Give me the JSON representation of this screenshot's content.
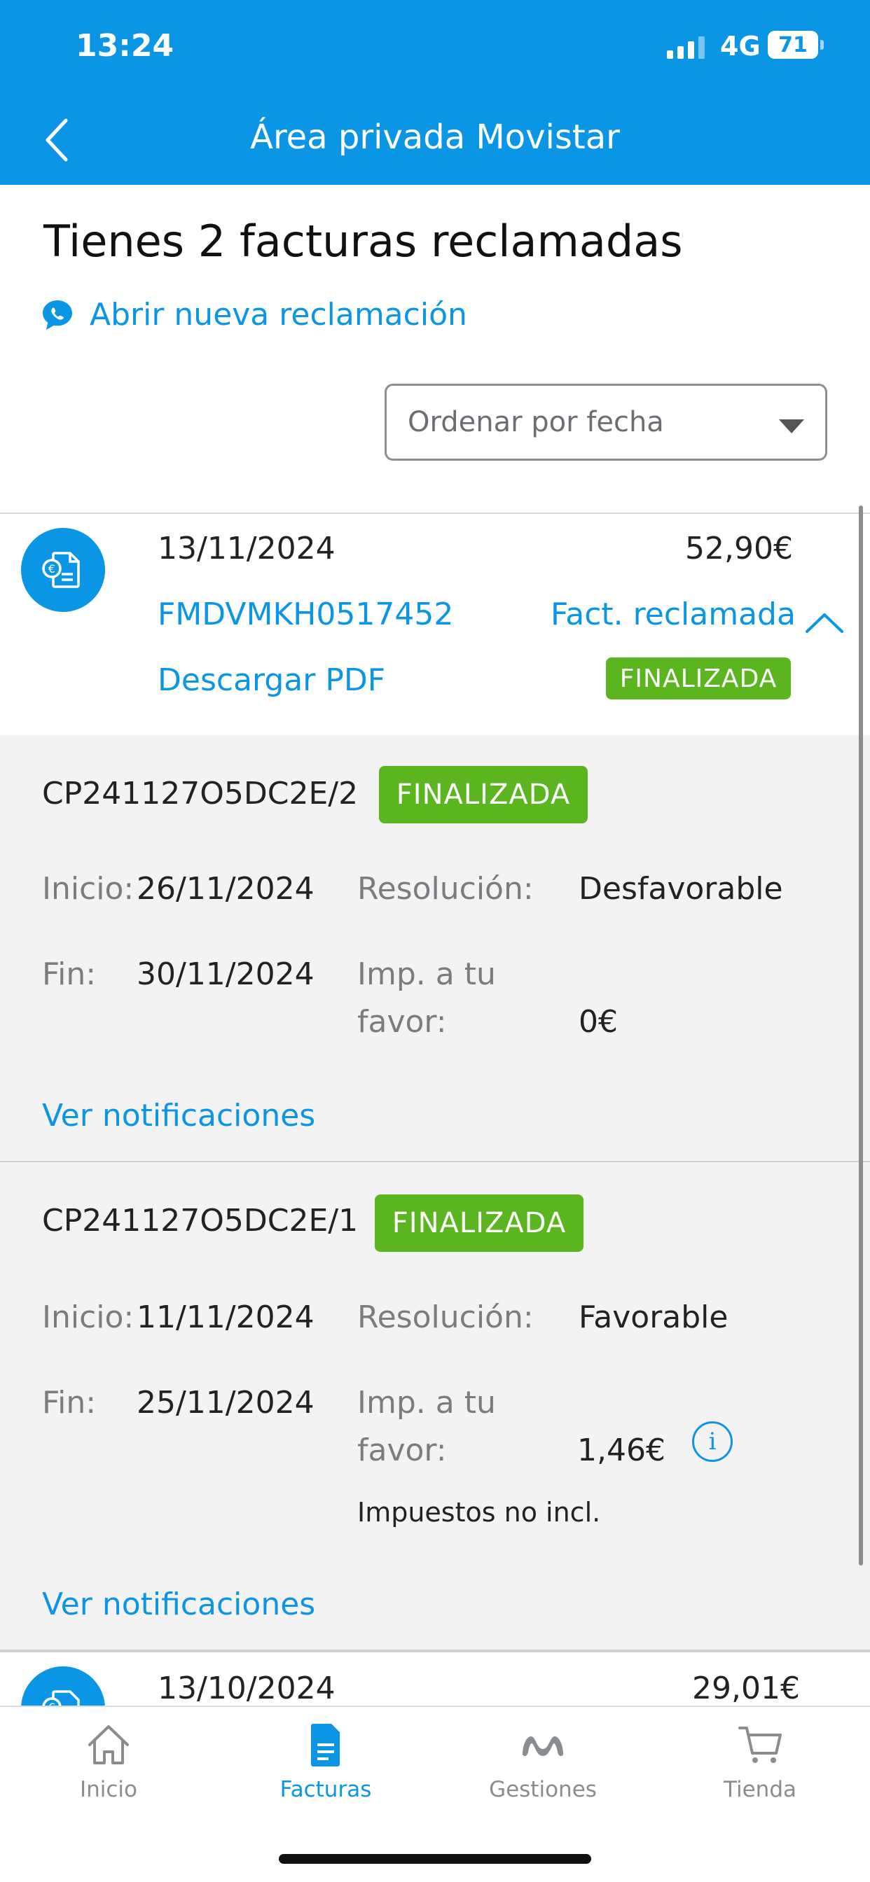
{
  "status": {
    "time": "13:24",
    "network": "4G",
    "battery": "71"
  },
  "header": {
    "title": "Área privada Movistar"
  },
  "page": {
    "heading": "Tienes 2 facturas reclamadas",
    "new_claim": "Abrir nueva reclamación"
  },
  "sort": {
    "value": "Ordenar por fecha"
  },
  "invoices": [
    {
      "date": "13/11/2024",
      "amount": "52,90€",
      "number": "FMDVMKH0517452",
      "claim_link": "Fact. reclamada",
      "download": "Descargar PDF",
      "status": "FINALIZADA"
    },
    {
      "date": "13/10/2024",
      "amount": "29,01€"
    }
  ],
  "claims": [
    {
      "id": "CP241127O5DC2E/2",
      "status": "FINALIZADA",
      "start_label": "Inicio:",
      "start": "26/11/2024",
      "end_label": "Fin:",
      "end": "30/11/2024",
      "resolution_label": "Resolución:",
      "resolution": "Desfavorable",
      "amount_label_1": "Imp. a tu",
      "amount_label_2": "favor:",
      "amount": "0€",
      "link": "Ver notificaciones"
    },
    {
      "id": "CP241127O5DC2E/1",
      "status": "FINALIZADA",
      "start_label": "Inicio:",
      "start": "11/11/2024",
      "end_label": "Fin:",
      "end": "25/11/2024",
      "resolution_label": "Resolución:",
      "resolution": "Favorable",
      "amount_label_1": "Imp. a tu",
      "amount_label_2": "favor:",
      "amount": "1,46€",
      "info_icon": "i",
      "tax_note": "Impuestos no incl.",
      "link": "Ver notificaciones"
    }
  ],
  "nav": [
    {
      "label": "Inicio",
      "icon": "home-icon"
    },
    {
      "label": "Facturas",
      "icon": "invoice-icon",
      "active": true
    },
    {
      "label": "Gestiones",
      "icon": "movistar-icon"
    },
    {
      "label": "Tienda",
      "icon": "cart-icon"
    }
  ],
  "colors": {
    "brand": "#0b96e5",
    "success": "#5bb51e",
    "panel": "#f3f3f3"
  }
}
